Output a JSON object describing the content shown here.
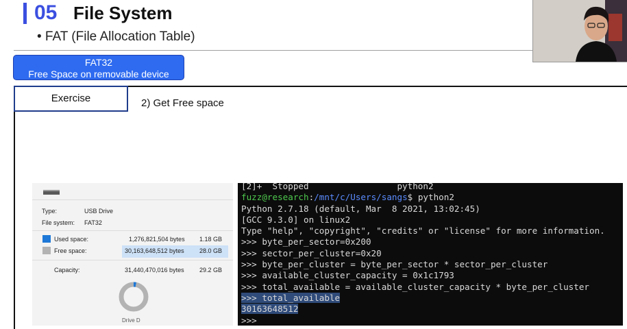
{
  "header": {
    "number": "05",
    "title": "File System",
    "subtitle": "• FAT (File Allocation Table)"
  },
  "badge": {
    "line1": "FAT32",
    "line2": "Free Space on removable device"
  },
  "exercise": {
    "label": "Exercise",
    "description": "2) Get Free space"
  },
  "properties": {
    "type_label": "Type:",
    "type_value": "USB Drive",
    "fs_label": "File system:",
    "fs_value": "FAT32",
    "used_label": "Used space:",
    "used_bytes": "1,276,821,504 bytes",
    "used_gb": "1.18 GB",
    "free_label": "Free space:",
    "free_bytes": "30,163,648,512 bytes",
    "free_gb": "28.0 GB",
    "capacity_label": "Capacity:",
    "capacity_bytes": "31,440,470,016 bytes",
    "capacity_gb": "29.2 GB",
    "used_color": "#1e78d7",
    "free_color": "#b3b3b3",
    "drive_label": "Drive D"
  },
  "terminal": {
    "line1": "[2]+  Stopped                 python2",
    "prompt_user": "fuzz@research",
    "prompt_sep": ":",
    "prompt_path": "/mnt/c/Users/sangs",
    "prompt_cmd": "$ python2",
    "line3": "Python 2.7.18 (default, Mar  8 2021, 13:02:45)",
    "line4": "[GCC 9.3.0] on linux2",
    "line5": "Type \"help\", \"copyright\", \"credits\" or \"license\" for more information.",
    "line6": ">>> byte_per_sector=0x200",
    "line7": ">>> sector_per_cluster=0x20",
    "line8": ">>> byte_per_cluster = byte_per_sector * sector_per_cluster",
    "line9": ">>> available_cluster_capacity = 0x1c1793",
    "line10": ">>> total_available = available_cluster_capacity * byte_per_cluster",
    "line11": ">>> total_available",
    "line12": "30163648512",
    "line13": ">>> "
  }
}
